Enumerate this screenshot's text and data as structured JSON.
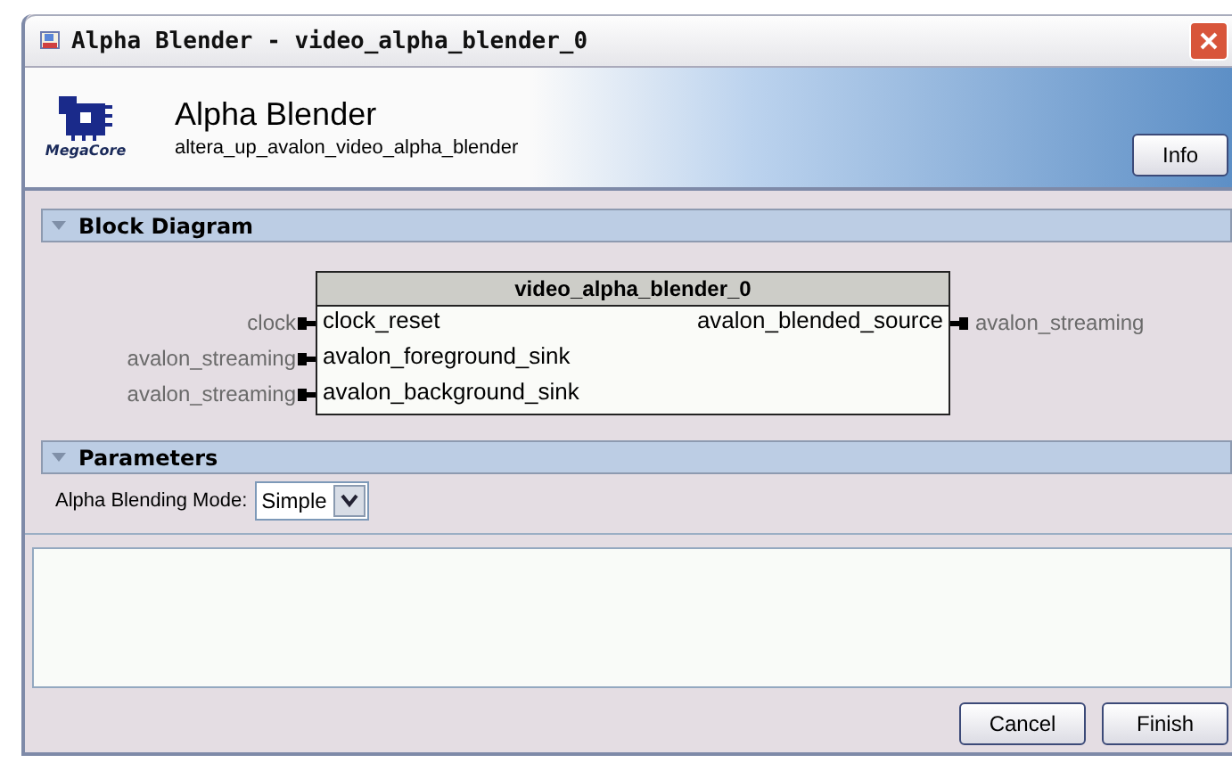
{
  "window": {
    "title": "Alpha Blender - video_alpha_blender_0"
  },
  "header": {
    "title": "Alpha Blender",
    "subtitle": "altera_up_avalon_video_alpha_blender",
    "logo_text": "MegaCore",
    "info_button": "Info"
  },
  "block_diagram": {
    "title": "Block Diagram",
    "expanded": true,
    "block": {
      "title": "video_alpha_blender_0",
      "input_ports": [
        {
          "name": "clock_reset",
          "interface": "clock"
        },
        {
          "name": "avalon_foreground_sink",
          "interface": "avalon_streaming"
        },
        {
          "name": "avalon_background_sink",
          "interface": "avalon_streaming"
        }
      ],
      "output_ports": [
        {
          "name": "avalon_blended_source",
          "interface": "avalon_streaming"
        }
      ]
    }
  },
  "parameters": {
    "title": "Parameters",
    "expanded": true,
    "fields": [
      {
        "label": "Alpha Blending Mode:",
        "value": "Simple"
      }
    ]
  },
  "buttons": [
    "Cancel",
    "Finish"
  ]
}
